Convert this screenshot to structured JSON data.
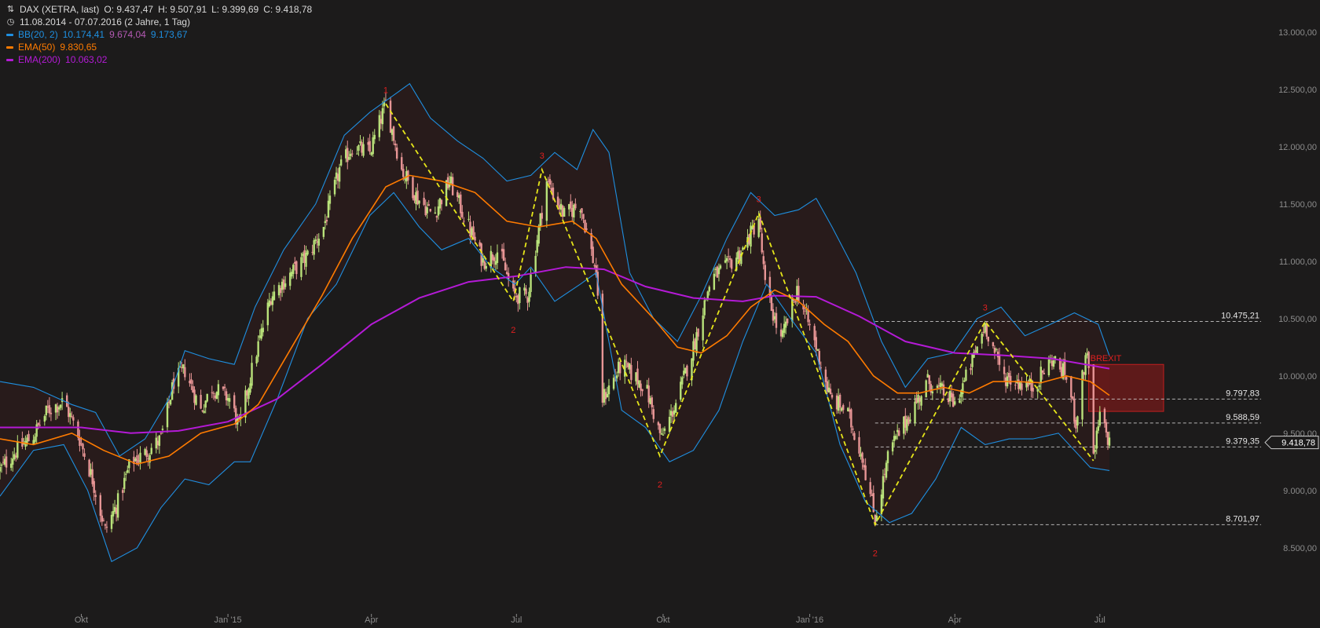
{
  "legend": {
    "instrument": "DAX (XETRA, last)",
    "ohlc": {
      "open": "O: 9.437,47",
      "high": "H: 9.507,91",
      "low": "L: 9.399,69",
      "close": "C: 9.418,78"
    },
    "period": "11.08.2014 - 07.07.2016 (2 Jahre, 1 Tag)",
    "bb": {
      "label": "BB(20, 2)",
      "upper": "10.174,41",
      "middle": "9.674,04",
      "lower": "9.173,67"
    },
    "ema50": {
      "label": "EMA(50)",
      "value": "9.830,65"
    },
    "ema200": {
      "label": "EMA(200)",
      "value": "10.063,02"
    },
    "icons": {
      "chart_type": "candles-icon",
      "period": "clock-icon"
    }
  },
  "colors": {
    "background": "#1c1b1b",
    "bb": "#1f8fe0",
    "bb_fill": "#2a1c1c",
    "ema50": "#ff7b00",
    "ema200": "#b41ad6",
    "candle_up": "#b9e27a",
    "candle_down": "#e79595",
    "pattern": "#e6e61a",
    "pattern_label": "#e02020",
    "brexit_box": "#7a1a1a",
    "axis_text": "#8c8c8c"
  },
  "chart_data": {
    "type": "line",
    "subtype": "candlestick with Bollinger Bands, EMA(50), EMA(200)",
    "title": "DAX (XETRA, last)",
    "x_range": [
      "2014-08-11",
      "2016-07-07"
    ],
    "ylim": [
      8300,
      13150
    ],
    "y_ticks": [
      8500,
      9000,
      9500,
      10000,
      10500,
      11000,
      11500,
      12000,
      12500,
      13000
    ],
    "y_tick_labels": [
      "8.500,00",
      "9.000,00",
      "9.500,00",
      "10.000,00",
      "10.500,00",
      "11.000,00",
      "11.500,00",
      "12.000,00",
      "12.500,00",
      "13.000,00"
    ],
    "x_ticks": [
      {
        "date": "2014-10-01",
        "label": "Okt"
      },
      {
        "date": "2015-01-01",
        "label": "Jan '15"
      },
      {
        "date": "2015-04-01",
        "label": "Apr"
      },
      {
        "date": "2015-07-01",
        "label": "Jul"
      },
      {
        "date": "2015-10-01",
        "label": "Okt"
      },
      {
        "date": "2016-01-01",
        "label": "Jan '16"
      },
      {
        "date": "2016-04-01",
        "label": "Apr"
      },
      {
        "date": "2016-07-01",
        "label": "Jul"
      }
    ],
    "close_path": [
      [
        "2014-08-11",
        9180
      ],
      [
        "2014-08-20",
        9330
      ],
      [
        "2014-09-01",
        9480
      ],
      [
        "2014-09-10",
        9700
      ],
      [
        "2014-09-20",
        9780
      ],
      [
        "2014-09-30",
        9450
      ],
      [
        "2014-10-08",
        9100
      ],
      [
        "2014-10-16",
        8650
      ],
      [
        "2014-10-24",
        8900
      ],
      [
        "2014-11-01",
        9250
      ],
      [
        "2014-11-10",
        9320
      ],
      [
        "2014-11-20",
        9450
      ],
      [
        "2014-11-28",
        9950
      ],
      [
        "2014-12-05",
        10050
      ],
      [
        "2014-12-15",
        9700
      ],
      [
        "2014-12-22",
        9900
      ],
      [
        "2015-01-02",
        9800
      ],
      [
        "2015-01-08",
        9550
      ],
      [
        "2015-01-16",
        10050
      ],
      [
        "2015-01-28",
        10700
      ],
      [
        "2015-02-10",
        10900
      ],
      [
        "2015-02-20",
        11050
      ],
      [
        "2015-03-02",
        11300
      ],
      [
        "2015-03-12",
        11800
      ],
      [
        "2015-03-20",
        12000
      ],
      [
        "2015-03-31",
        11950
      ],
      [
        "2015-04-10",
        12374
      ],
      [
        "2015-04-20",
        11800
      ],
      [
        "2015-04-30",
        11550
      ],
      [
        "2015-05-10",
        11400
      ],
      [
        "2015-05-20",
        11700
      ],
      [
        "2015-06-01",
        11300
      ],
      [
        "2015-06-10",
        11000
      ],
      [
        "2015-06-20",
        11100
      ],
      [
        "2015-06-29",
        10700
      ],
      [
        "2015-07-08",
        10700
      ],
      [
        "2015-07-20",
        11700
      ],
      [
        "2015-07-31",
        11400
      ],
      [
        "2015-08-10",
        11500
      ],
      [
        "2015-08-20",
        10900
      ],
      [
        "2015-08-24",
        9800
      ],
      [
        "2015-09-05",
        10100
      ],
      [
        "2015-09-20",
        9900
      ],
      [
        "2015-09-30",
        9450
      ],
      [
        "2015-10-10",
        9800
      ],
      [
        "2015-10-20",
        10250
      ],
      [
        "2015-10-31",
        10850
      ],
      [
        "2015-11-10",
        10950
      ],
      [
        "2015-11-20",
        11100
      ],
      [
        "2015-11-30",
        11380
      ],
      [
        "2015-12-04",
        10780
      ],
      [
        "2015-12-14",
        10300
      ],
      [
        "2015-12-24",
        10750
      ],
      [
        "2016-01-04",
        10300
      ],
      [
        "2016-01-14",
        9800
      ],
      [
        "2016-01-24",
        9700
      ],
      [
        "2016-02-03",
        9300
      ],
      [
        "2016-02-11",
        8750
      ],
      [
        "2016-02-20",
        9350
      ],
      [
        "2016-03-01",
        9600
      ],
      [
        "2016-03-15",
        9950
      ],
      [
        "2016-03-25",
        9850
      ],
      [
        "2016-04-01",
        9750
      ],
      [
        "2016-04-10",
        10050
      ],
      [
        "2016-04-20",
        10450
      ],
      [
        "2016-05-01",
        10000
      ],
      [
        "2016-05-10",
        9950
      ],
      [
        "2016-05-20",
        9900
      ],
      [
        "2016-06-01",
        10150
      ],
      [
        "2016-06-10",
        10000
      ],
      [
        "2016-06-16",
        9600
      ],
      [
        "2016-06-23",
        10250
      ],
      [
        "2016-06-27",
        9270
      ],
      [
        "2016-07-01",
        9650
      ],
      [
        "2016-07-07",
        9418.78
      ]
    ],
    "bb_upper": [
      [
        "2014-08-11",
        9950
      ],
      [
        "2014-09-01",
        9900
      ],
      [
        "2014-09-25",
        9750
      ],
      [
        "2014-10-10",
        9680
      ],
      [
        "2014-10-25",
        9300
      ],
      [
        "2014-11-10",
        9450
      ],
      [
        "2014-11-25",
        9800
      ],
      [
        "2014-12-05",
        10220
      ],
      [
        "2014-12-20",
        10150
      ],
      [
        "2015-01-05",
        10100
      ],
      [
        "2015-01-18",
        10600
      ],
      [
        "2015-02-05",
        11100
      ],
      [
        "2015-02-25",
        11500
      ],
      [
        "2015-03-15",
        12100
      ],
      [
        "2015-03-31",
        12300
      ],
      [
        "2015-04-15",
        12450
      ],
      [
        "2015-04-25",
        12550
      ],
      [
        "2015-05-08",
        12250
      ],
      [
        "2015-05-25",
        12050
      ],
      [
        "2015-06-10",
        11900
      ],
      [
        "2015-06-25",
        11700
      ],
      [
        "2015-07-10",
        11750
      ],
      [
        "2015-07-25",
        11950
      ],
      [
        "2015-08-08",
        11800
      ],
      [
        "2015-08-18",
        12150
      ],
      [
        "2015-08-28",
        11950
      ],
      [
        "2015-09-10",
        10900
      ],
      [
        "2015-09-25",
        10500
      ],
      [
        "2015-10-10",
        10300
      ],
      [
        "2015-10-25",
        10700
      ],
      [
        "2015-11-10",
        11200
      ],
      [
        "2015-11-25",
        11600
      ],
      [
        "2015-12-10",
        11400
      ],
      [
        "2015-12-25",
        11450
      ],
      [
        "2016-01-05",
        11550
      ],
      [
        "2016-01-15",
        11300
      ],
      [
        "2016-01-30",
        10900
      ],
      [
        "2016-02-15",
        10300
      ],
      [
        "2016-03-01",
        9900
      ],
      [
        "2016-03-15",
        10150
      ],
      [
        "2016-03-31",
        10200
      ],
      [
        "2016-04-15",
        10500
      ],
      [
        "2016-04-30",
        10600
      ],
      [
        "2016-05-15",
        10350
      ],
      [
        "2016-05-31",
        10450
      ],
      [
        "2016-06-15",
        10550
      ],
      [
        "2016-06-30",
        10450
      ],
      [
        "2016-07-07",
        10174
      ]
    ],
    "bb_lower": [
      [
        "2014-08-11",
        8950
      ],
      [
        "2014-09-01",
        9350
      ],
      [
        "2014-09-20",
        9400
      ],
      [
        "2014-10-05",
        9000
      ],
      [
        "2014-10-20",
        8380
      ],
      [
        "2014-11-05",
        8500
      ],
      [
        "2014-11-20",
        8850
      ],
      [
        "2014-12-05",
        9100
      ],
      [
        "2014-12-20",
        9050
      ],
      [
        "2015-01-05",
        9250
      ],
      [
        "2015-01-15",
        9250
      ],
      [
        "2015-02-01",
        9800
      ],
      [
        "2015-02-20",
        10500
      ],
      [
        "2015-03-10",
        10800
      ],
      [
        "2015-03-31",
        11400
      ],
      [
        "2015-04-15",
        11600
      ],
      [
        "2015-05-01",
        11300
      ],
      [
        "2015-05-15",
        11100
      ],
      [
        "2015-06-01",
        11200
      ],
      [
        "2015-06-15",
        10950
      ],
      [
        "2015-06-30",
        10800
      ],
      [
        "2015-07-10",
        10950
      ],
      [
        "2015-07-25",
        10650
      ],
      [
        "2015-08-10",
        10800
      ],
      [
        "2015-08-20",
        10900
      ],
      [
        "2015-09-05",
        9700
      ],
      [
        "2015-09-20",
        9550
      ],
      [
        "2015-10-05",
        9250
      ],
      [
        "2015-10-20",
        9350
      ],
      [
        "2015-11-05",
        9700
      ],
      [
        "2015-11-20",
        10300
      ],
      [
        "2015-12-05",
        10800
      ],
      [
        "2015-12-20",
        10500
      ],
      [
        "2016-01-05",
        10200
      ],
      [
        "2016-01-20",
        9400
      ],
      [
        "2016-02-05",
        8900
      ],
      [
        "2016-02-20",
        8720
      ],
      [
        "2016-03-05",
        8800
      ],
      [
        "2016-03-20",
        9100
      ],
      [
        "2016-04-05",
        9550
      ],
      [
        "2016-04-20",
        9400
      ],
      [
        "2016-05-05",
        9450
      ],
      [
        "2016-05-20",
        9450
      ],
      [
        "2016-06-05",
        9500
      ],
      [
        "2016-06-25",
        9200
      ],
      [
        "2016-07-07",
        9174
      ]
    ],
    "ema50": [
      [
        "2014-08-11",
        9450
      ],
      [
        "2014-09-01",
        9400
      ],
      [
        "2014-09-25",
        9500
      ],
      [
        "2014-10-15",
        9350
      ],
      [
        "2014-11-05",
        9230
      ],
      [
        "2014-11-25",
        9300
      ],
      [
        "2014-12-15",
        9500
      ],
      [
        "2015-01-05",
        9580
      ],
      [
        "2015-01-20",
        9750
      ],
      [
        "2015-02-10",
        10250
      ],
      [
        "2015-03-01",
        10700
      ],
      [
        "2015-03-20",
        11200
      ],
      [
        "2015-04-10",
        11650
      ],
      [
        "2015-04-25",
        11750
      ],
      [
        "2015-05-15",
        11700
      ],
      [
        "2015-06-05",
        11600
      ],
      [
        "2015-06-25",
        11350
      ],
      [
        "2015-07-15",
        11300
      ],
      [
        "2015-08-05",
        11350
      ],
      [
        "2015-08-20",
        11200
      ],
      [
        "2015-09-05",
        10800
      ],
      [
        "2015-09-25",
        10500
      ],
      [
        "2015-10-10",
        10250
      ],
      [
        "2015-10-25",
        10200
      ],
      [
        "2015-11-10",
        10350
      ],
      [
        "2015-11-25",
        10600
      ],
      [
        "2015-12-10",
        10750
      ],
      [
        "2015-12-25",
        10650
      ],
      [
        "2016-01-10",
        10450
      ],
      [
        "2016-01-25",
        10300
      ],
      [
        "2016-02-10",
        10000
      ],
      [
        "2016-02-25",
        9850
      ],
      [
        "2016-03-10",
        9850
      ],
      [
        "2016-03-25",
        9900
      ],
      [
        "2016-04-10",
        9850
      ],
      [
        "2016-04-25",
        9950
      ],
      [
        "2016-05-10",
        9950
      ],
      [
        "2016-05-25",
        9940
      ],
      [
        "2016-06-10",
        10000
      ],
      [
        "2016-06-25",
        9950
      ],
      [
        "2016-07-07",
        9830.65
      ]
    ],
    "ema200": [
      [
        "2014-08-11",
        9550
      ],
      [
        "2014-09-01",
        9550
      ],
      [
        "2014-10-01",
        9550
      ],
      [
        "2014-11-01",
        9500
      ],
      [
        "2014-12-01",
        9520
      ],
      [
        "2015-01-01",
        9600
      ],
      [
        "2015-02-01",
        9800
      ],
      [
        "2015-03-01",
        10100
      ],
      [
        "2015-04-01",
        10450
      ],
      [
        "2015-05-01",
        10680
      ],
      [
        "2015-06-01",
        10820
      ],
      [
        "2015-07-01",
        10870
      ],
      [
        "2015-08-01",
        10950
      ],
      [
        "2015-08-25",
        10930
      ],
      [
        "2015-09-20",
        10780
      ],
      [
        "2015-10-20",
        10680
      ],
      [
        "2015-11-20",
        10650
      ],
      [
        "2015-12-10",
        10700
      ],
      [
        "2016-01-05",
        10690
      ],
      [
        "2016-02-01",
        10520
      ],
      [
        "2016-03-01",
        10300
      ],
      [
        "2016-04-01",
        10200
      ],
      [
        "2016-05-01",
        10180
      ],
      [
        "2016-06-01",
        10150
      ],
      [
        "2016-07-07",
        10063.02
      ]
    ],
    "pattern": {
      "points": [
        [
          "2015-04-10",
          12374,
          "1"
        ],
        [
          "2015-06-29",
          10650,
          "2"
        ],
        [
          "2015-07-17",
          11800,
          "3"
        ],
        [
          "2015-09-29",
          9300,
          "2"
        ],
        [
          "2015-11-30",
          11420,
          "3"
        ],
        [
          "2016-02-11",
          8702,
          "2"
        ],
        [
          "2016-04-20",
          10475,
          "3"
        ],
        [
          "2016-06-27",
          9260,
          ""
        ]
      ]
    },
    "levels": [
      {
        "value": 10475.21,
        "label": "10.475,21",
        "from": "2016-02-11"
      },
      {
        "value": 9797.83,
        "label": "9.797,83",
        "from": "2016-02-11"
      },
      {
        "value": 9588.59,
        "label": "9.588,59",
        "from": "2016-02-11"
      },
      {
        "value": 9379.35,
        "label": "9.379,35",
        "from": "2016-02-11"
      },
      {
        "value": 8701.97,
        "label": "8.701,97",
        "from": "2016-02-11"
      }
    ],
    "brexit_zone": {
      "label": "BREXIT",
      "from": "2016-06-24",
      "to": "2016-08-10",
      "top": 10100,
      "bottom": 9690
    },
    "last_price": {
      "value": 9418.78,
      "label": "9.418,78"
    }
  }
}
